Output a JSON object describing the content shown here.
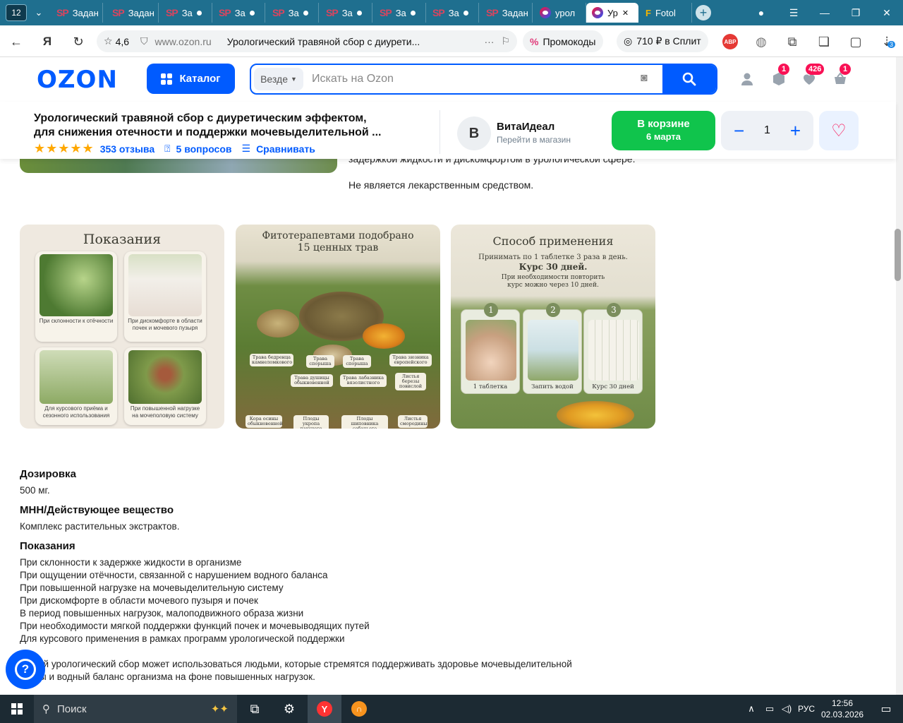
{
  "browser": {
    "tab_count": "12",
    "tabs": [
      {
        "fav": "SP",
        "label": "Задан"
      },
      {
        "fav": "SP",
        "label": "Задан"
      },
      {
        "fav": "SP",
        "label": "За"
      },
      {
        "fav": "SP",
        "label": "За"
      },
      {
        "fav": "SP",
        "label": "За"
      },
      {
        "fav": "SP",
        "label": "За"
      },
      {
        "fav": "SP",
        "label": "За"
      },
      {
        "fav": "SP",
        "label": "За"
      },
      {
        "fav": "SP",
        "label": "Задан"
      },
      {
        "fav": "ozon",
        "label": "урол"
      },
      {
        "fav": "ozon",
        "label": "Ур",
        "active": true
      },
      {
        "fav": "F",
        "label": "Fotol"
      }
    ],
    "rating": "4,6",
    "url": "www.ozon.ru",
    "page_title": "Урологический травяной сбор с диурети...",
    "promo_label": "Промокоды",
    "split_label": "710 ₽ в Сплит",
    "abp_label": "ABP",
    "download_count": "3"
  },
  "header": {
    "logo": "OZON",
    "catalog_label": "Каталог",
    "search_scope": "Везде",
    "search_placeholder": "Искать на Ozon",
    "badges": {
      "orders": "1",
      "favorites": "426",
      "cart": "1"
    }
  },
  "product": {
    "title_line1": "Урологический травяной сбор с диуретическим эффектом,",
    "title_line2": "для снижения отечности и поддержки мочевыделительной ...",
    "reviews": "353 отзыва",
    "questions": "5 вопросов",
    "compare": "Сравнивать",
    "shop_initial": "В",
    "shop_name": "ВитаИдеал",
    "shop_link": "Перейти в магазин",
    "cart_line1": "В корзине",
    "cart_line2": "6 марта",
    "quantity": "1"
  },
  "description": {
    "line_partial": "задержкой жидкости и дискомфортом в урологической сфере.",
    "line_not_drug": "Не является лекарственным средством."
  },
  "gallery": {
    "card1": {
      "title": "Показания",
      "tiles": [
        "При склонности к отёчности",
        "При дискомфорте в области почек и мочевого пузыря",
        "Для курсового приёма и сезонного использования",
        "При повышенной нагрузке на мочеполовую систему"
      ]
    },
    "card2": {
      "title": "Фитотерапевтами подобрано 15 ценных трав",
      "labels": [
        "Трава бедренца камнеломкового",
        "Трава спорыша",
        "Трава спорыша",
        "Трава зюзника европейского",
        "Трава душицы обыкновенной",
        "Трава лабазника вязолистного",
        "Листья березы повислой",
        "Кора осины обыкновенной",
        "Плоды укропа пахучего",
        "Плоды шиповника собачьего",
        "Листья смородины"
      ]
    },
    "card3": {
      "title": "Способ применения",
      "line1": "Принимать по 1 таблетке 3 раза в день.",
      "line2": "Курс 30 дней.",
      "line3": "При необходимости повторить курс можно через 10 дней.",
      "steps": [
        {
          "num": "1",
          "caption": "1 таблетка"
        },
        {
          "num": "2",
          "caption": "Запить водой"
        },
        {
          "num": "3",
          "caption": "Курс 30 дней"
        }
      ]
    }
  },
  "specs": [
    {
      "heading": "Дозировка",
      "value": "500 мг."
    },
    {
      "heading": "МНН/Действующее вещество",
      "value": "Комплекс растительных экстрактов."
    },
    {
      "heading": "Показания",
      "lines": [
        "При склонности к задержке жидкости в организме",
        "При ощущении отёчности, связанной с нарушением водного баланса",
        "При повышенной нагрузке на мочевыделительную систему",
        "При дискомфорте в области мочевого пузыря и почек",
        "В период повышенных нагрузок, малоподвижного образа жизни",
        "При необходимости мягкой поддержки функций почек и мочевыводящих путей",
        "Для курсового применения в рамках программ урологической поддержки"
      ]
    }
  ],
  "footer_text": {
    "line1": "...яной урологический сбор может использоваться людьми, которые стремятся поддерживать здоровье мочевыделительной",
    "line2": "...емы и водный баланс организма на фоне повышенных нагрузок."
  },
  "taskbar": {
    "search_label": "Поиск",
    "lang": "РУС",
    "time": "12:56",
    "date": "02.03.2026"
  },
  "colors": {
    "brand": "#005bff",
    "accent_pink": "#f91155",
    "cart_green": "#10c44c"
  }
}
